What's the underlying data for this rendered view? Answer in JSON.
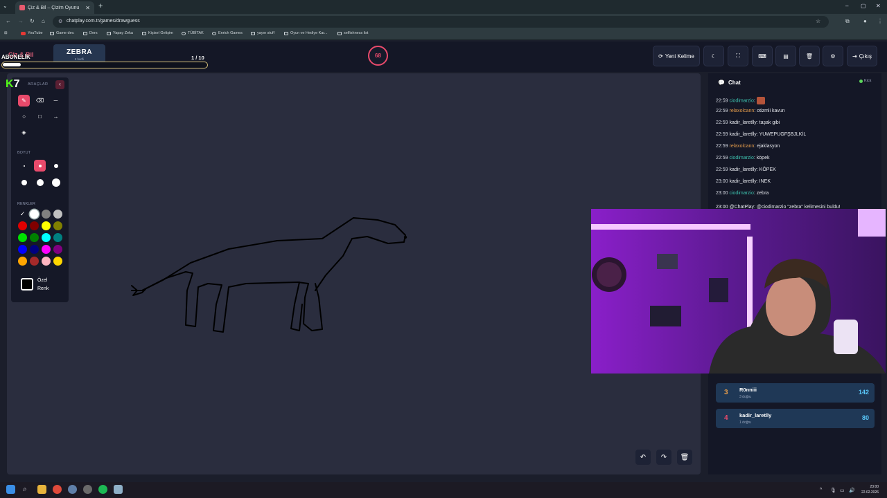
{
  "browser": {
    "tab_title": "Çiz & Bil – Çizim Oyunu",
    "url": "chatplay.com.tr/games/drawguess",
    "bookmarks": [
      "YouTube",
      "Game dev.",
      "Ders",
      "Yapay Zeka",
      "Kişisel Gelişim",
      "TÜBİTAK",
      "Enrich Games",
      "yayın stuff",
      "Oyun ve Hediye Kar...",
      "selfishness list"
    ]
  },
  "header": {
    "logo": "Çiz & Bil",
    "overlay_label": "ABONELİK",
    "word": "ZEBRA",
    "word_sub": "5 harfli",
    "round": "1  / 10",
    "progress_fraction": 0.09,
    "timer": "68",
    "new_word_label": "Yeni Kelime",
    "exit_label": "Çıkış"
  },
  "tools": {
    "overlay_k": "K",
    "overlay_num": "7",
    "section_tools": "ARAÇLAR",
    "section_size": "BOYUT",
    "section_colors": "RENKLER",
    "custom_color_line1": "Özel",
    "custom_color_line2": "Renk",
    "palette": [
      "#000000",
      "#ffffff",
      "#808080",
      "#c0c0c0",
      "#e00000",
      "#800000",
      "#ffff00",
      "#808000",
      "#00e000",
      "#008000",
      "#00ffff",
      "#008080",
      "#0000ff",
      "#000080",
      "#ff00ff",
      "#800080",
      "#ffa500",
      "#a52a2a",
      "#ffb6c1",
      "#ffd700"
    ]
  },
  "chat": {
    "title": "Chat",
    "status": "Kick",
    "messages": [
      {
        "time": "22:59",
        "user": "ciodimarzio",
        "msg": "",
        "c": "n1"
      },
      {
        "time": "22:59",
        "user": "relaxolcann",
        "msg": "otizmli kavun",
        "c": "n2"
      },
      {
        "time": "22:59",
        "user": "kadir_laretlly",
        "msg": "taşak gibi",
        "c": "n3"
      },
      {
        "time": "22:59",
        "user": "kadir_laretlly",
        "msg": "YUWEPUGFŞBJLKİL",
        "c": "n3"
      },
      {
        "time": "22:59",
        "user": "relaxolcann",
        "msg": "ejaklasyon",
        "c": "n2"
      },
      {
        "time": "22:59",
        "user": "ciodimarzio",
        "msg": "köpek",
        "c": "n1"
      },
      {
        "time": "22:59",
        "user": "kadir_laretlly",
        "msg": "KÖPEK",
        "c": "n3"
      },
      {
        "time": "23:00",
        "user": "kadir_laretlly",
        "msg": "INEK",
        "c": "n3"
      },
      {
        "time": "23:00",
        "user": "ciodimarzio",
        "msg": "zebra",
        "c": "n1"
      }
    ],
    "system_message": "23:00 @ChatPlay: @ciodimarzio \"zebra\" kelimesini buldu!"
  },
  "scores": [
    {
      "rank": "3",
      "name": "R0nniii",
      "sub": "3 doğru",
      "points": "142",
      "color": "#e39b4b"
    },
    {
      "rank": "4",
      "name": "kadir_laretlly",
      "sub": "1 doğru",
      "points": "80",
      "color": "#e84a6b"
    }
  ],
  "taskbar": {
    "time": "23:00",
    "date": "22.02.2026"
  }
}
